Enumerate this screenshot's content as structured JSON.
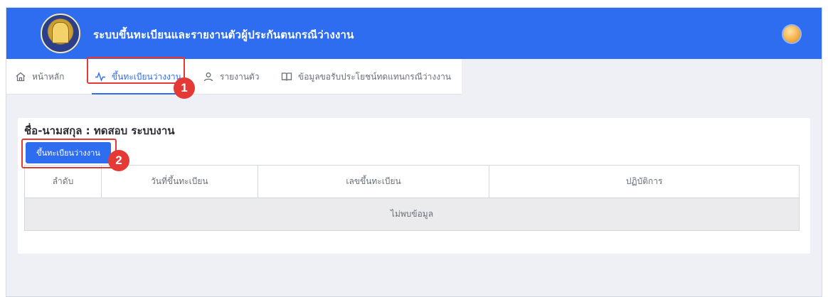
{
  "header": {
    "app_title": "ระบบขึ้นทะเบียนและรายงานตัวผู้ประกันตนกรณีว่างงาน",
    "logo": "department-seal-logo",
    "avatar": "user-avatar"
  },
  "nav": {
    "items": [
      {
        "label": "หน้าหลัก",
        "icon": "home-icon"
      },
      {
        "label": "ขึ้นทะเบียนว่างงาน",
        "icon": "activity-icon"
      },
      {
        "label": "รายงานตัว",
        "icon": "user-icon"
      },
      {
        "label": "ข้อมูลขอรับประโยชน์ทดแทนกรณีว่างงาน",
        "icon": "book-icon"
      }
    ],
    "active_index": 1
  },
  "content": {
    "person_name": "ชื่อ-นามสกุล : ทดสอบ ระบบงาน",
    "register_button_label": "ขึ้นทะเบียนว่างงาน",
    "table": {
      "columns": [
        "ลำดับ",
        "วันที่ขึ้นทะเบียน",
        "เลขขึ้นทะเบียน",
        "ปฏิบัติการ"
      ],
      "empty_message": "ไม่พบข้อมูล"
    }
  },
  "annotations": {
    "marker_1": "1",
    "marker_2": "2"
  },
  "colors": {
    "primary": "#2f6df0",
    "highlight": "#e53935",
    "background": "#eef0f6"
  }
}
